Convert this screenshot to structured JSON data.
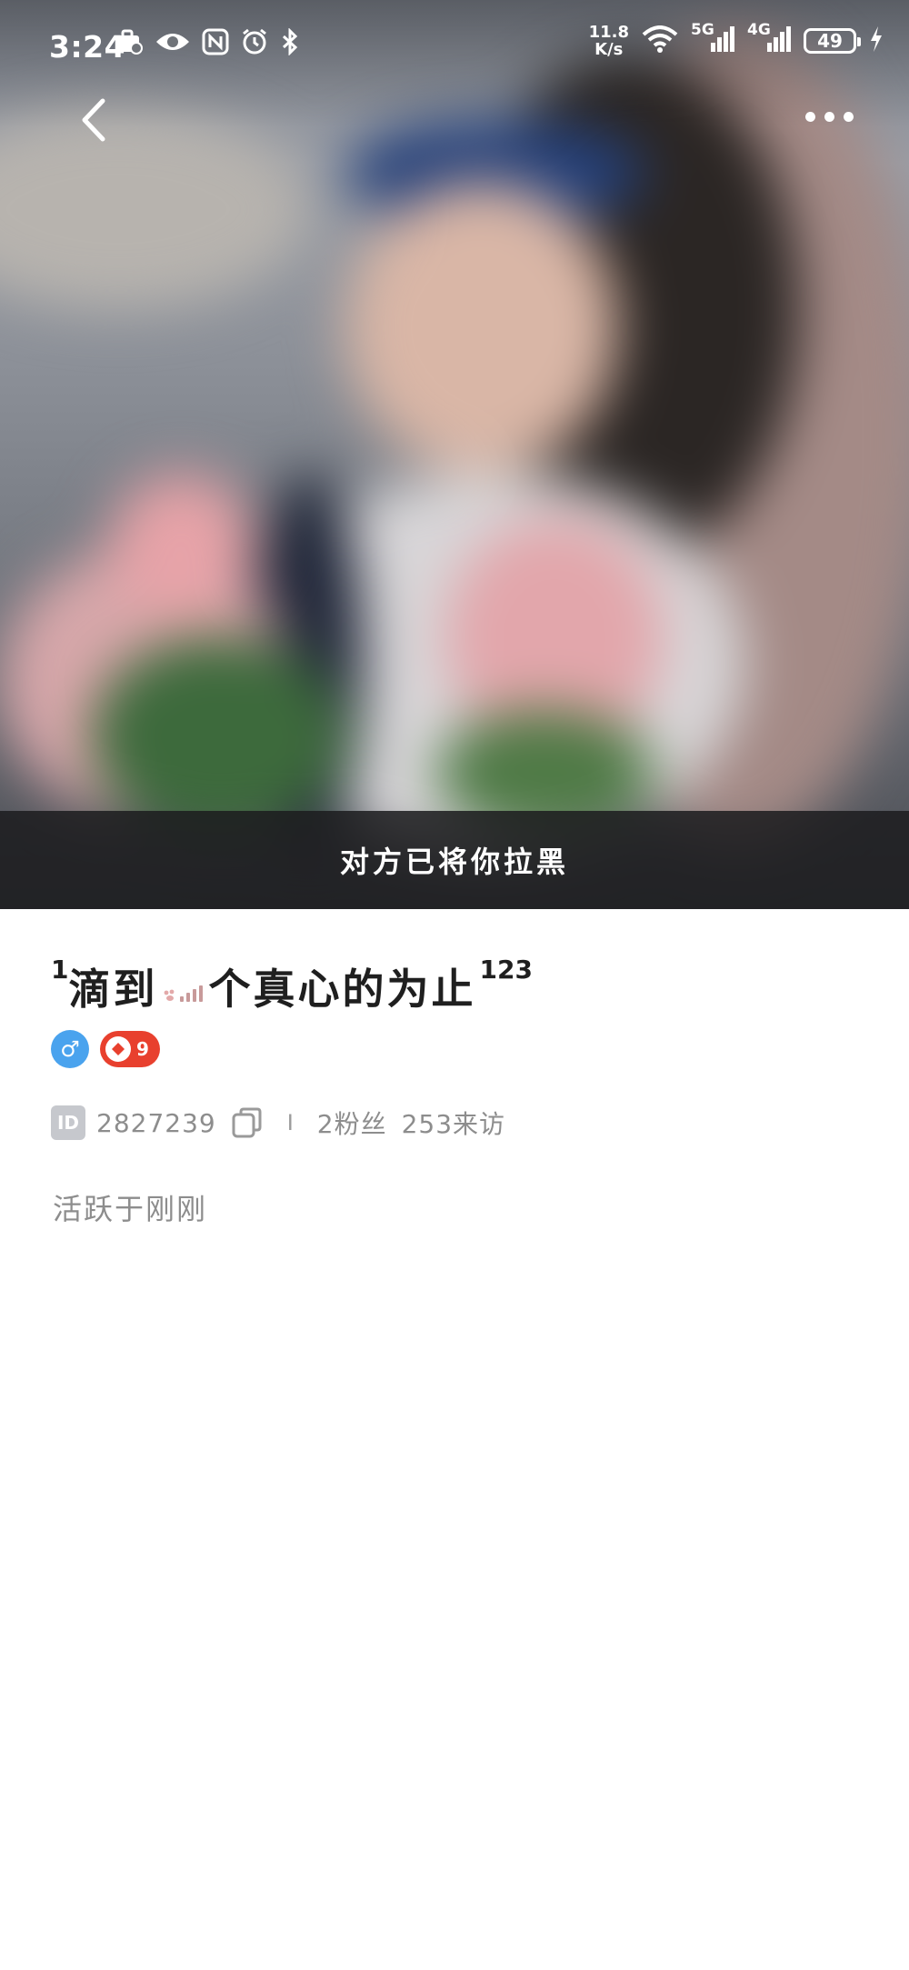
{
  "status_bar": {
    "time": "3:24",
    "net_speed_value": "11.8",
    "net_speed_unit": "K/s",
    "net_5g": "5G",
    "net_4g": "4G",
    "battery": "49",
    "icons": [
      "bag-icon",
      "eye-icon",
      "nfc-icon",
      "alarm-icon",
      "bluetooth-icon",
      "wifi-icon",
      "signal-5g-icon",
      "signal-4g-icon",
      "battery-icon",
      "charging-icon"
    ]
  },
  "header": {
    "back_icon": "chevron-left-icon",
    "more_icon": "more-horizontal-icon"
  },
  "cover": {
    "blocked_message": "对方已将你拉黑"
  },
  "profile": {
    "name_prefix_sup": "1",
    "name_part1": "滴到",
    "name_part2": "个真心的为止",
    "name_suffix_sup": "123",
    "gender_symbol": "♂",
    "level": "9",
    "id_label": "ID",
    "user_id": "2827239",
    "separator": "I",
    "fans": "2粉丝",
    "visitors": "253来访",
    "active_status": "活跃于刚刚"
  },
  "colors": {
    "gender_badge": "#4aa3ee",
    "level_badge": "#e8402e",
    "banner_bg": "#1c1c1e",
    "meta_text": "#8d8d8d"
  }
}
